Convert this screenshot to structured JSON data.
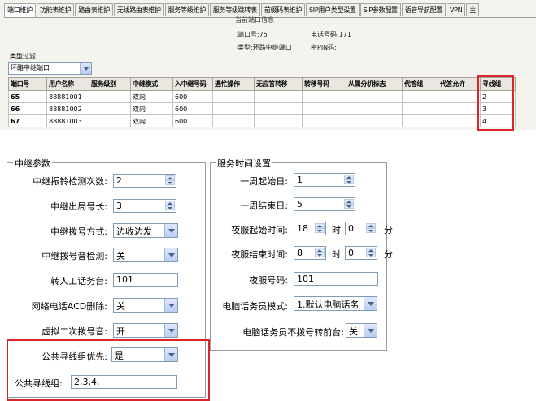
{
  "tabs": [
    "端口维护",
    "功能表维护",
    "路由表维护",
    "无线路由表维护",
    "服务等级维护",
    "服务等级跳转表",
    "前缀码表维护",
    "SIP用户类型设置",
    "SIP参数配置",
    "语音导航配置",
    "VPN",
    "主"
  ],
  "port_info": {
    "title": "当前端口信息",
    "port_label": "端口号:75",
    "phone_label": "电话号码:171",
    "type_label": "类型:环路中继端口",
    "pin_label": "密PIN码:"
  },
  "filter": {
    "label": "类型过滤:",
    "value": "环路中继端口"
  },
  "table": {
    "headers": [
      "端口号",
      "用户名称",
      "服务级别",
      "中继模式",
      "入中继号码",
      "遇忙操作",
      "无应答转移",
      "转移号码",
      "从属分机标志",
      "代答组",
      "代答允许",
      "寻线组"
    ],
    "rows": [
      [
        "65",
        "88881001",
        "",
        "双向",
        "600",
        "",
        "",
        "",
        "",
        "",
        "",
        "2"
      ],
      [
        "66",
        "88881002",
        "",
        "双向",
        "600",
        "",
        "",
        "",
        "",
        "",
        "",
        "3"
      ],
      [
        "67",
        "88881003",
        "",
        "双向",
        "600",
        "",
        "",
        "",
        "",
        "",
        "",
        "4"
      ]
    ]
  },
  "trunk": {
    "legend": "中继参数",
    "ring_count_label": "中继振铃检测次数:",
    "ring_count_value": "2",
    "out_len_label": "中继出局号长:",
    "out_len_value": "3",
    "dial_mode_label": "中继拨号方式:",
    "dial_mode_value": "边收边发",
    "dial_tone_label": "中继拨号音检测:",
    "dial_tone_value": "关",
    "operator_label": "转人工话务台:",
    "operator_value": "101",
    "acd_label": "网络电话ACD删除:",
    "acd_value": "关",
    "virtual_tone_label": "虚拟二次拨号音:",
    "virtual_tone_value": "开",
    "hunt_priority_label": "公共寻线组优先:",
    "hunt_priority_value": "是",
    "hunt_group_label": "公共寻线组:",
    "hunt_group_value": "2,3,4,"
  },
  "service": {
    "legend": "服务时间设置",
    "week_start_label": "一周起始日:",
    "week_start_value": "1",
    "week_end_label": "一周结束日:",
    "week_end_value": "5",
    "night_start_label": "夜服起始时间:",
    "night_start_hour": "18",
    "night_start_min": "0",
    "night_end_label": "夜服结束时间:",
    "night_end_hour": "8",
    "night_end_min": "0",
    "hour_unit": "时",
    "min_unit": "分",
    "night_number_label": "夜服号码:",
    "night_number_value": "101",
    "pc_mode_label": "电脑话务员模式:",
    "pc_mode_value": "1.默认电脑话务",
    "pc_no_dial_label": "电脑话务员不拨号转前台:",
    "pc_no_dial_value": "关"
  }
}
